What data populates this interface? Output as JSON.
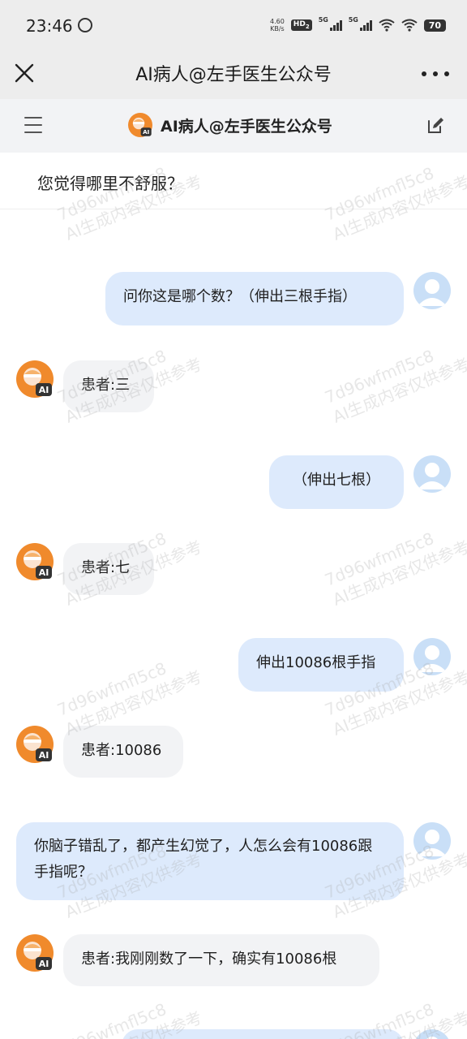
{
  "status_bar": {
    "time": "23:46",
    "net_speed_value": "4.60",
    "net_speed_unit": "KB/s",
    "hd_label": "HD",
    "hd_sub": "1",
    "hd_sub2": "2",
    "sim1_label": "5G",
    "sim2_label": "5G",
    "battery": "70"
  },
  "title_bar": {
    "title": "AI病人@左手医生公众号"
  },
  "sub_header": {
    "title": "AI病人@左手医生公众号"
  },
  "question": {
    "text": "您觉得哪里不舒服？"
  },
  "messages": [
    {
      "role": "user",
      "text": "问你这是哪个数？（伸出三根手指）"
    },
    {
      "role": "ai",
      "text": "患者:三"
    },
    {
      "role": "user",
      "text": "（伸出七根）"
    },
    {
      "role": "ai",
      "text": "患者:七"
    },
    {
      "role": "user",
      "text": "伸出10086根手指"
    },
    {
      "role": "ai",
      "text": "患者:10086"
    },
    {
      "role": "user",
      "text": "你脑子错乱了，都产生幻觉了，人怎么会有10086跟手指呢？"
    },
    {
      "role": "ai",
      "text": "患者:我刚刚数了一下，确实有10086根"
    }
  ],
  "watermark": {
    "line1": "7d96wfmfl5c8",
    "line2": "AI生成内容仅供参考"
  },
  "colors": {
    "user_bubble": "#ddeafc",
    "ai_bubble": "#f2f3f5",
    "header_bg": "#ededed",
    "avatar_orange": "#f08a2c"
  }
}
